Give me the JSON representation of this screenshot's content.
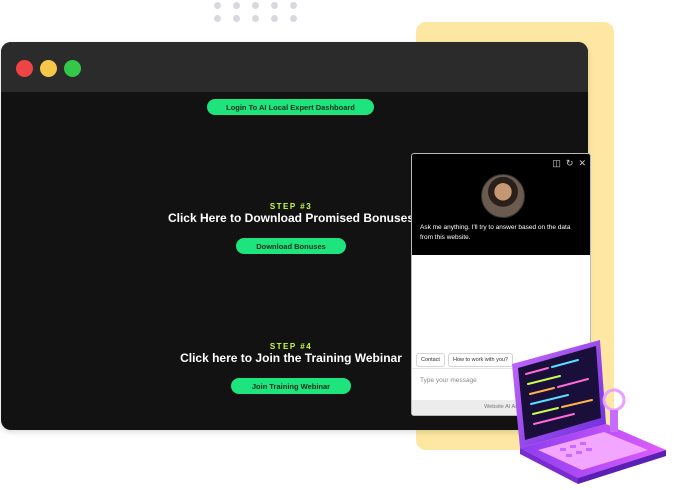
{
  "traffic_lights": {
    "close_color": "#ef4444",
    "minimize_color": "#f6c84a",
    "maximize_color": "#34c84a"
  },
  "dashboard_button": {
    "label": "Login To AI Local Expert Dashboard"
  },
  "step3": {
    "step_label": "STEP #3",
    "heading": "Click Here to Download Promised Bonuses",
    "button_label": "Download Bonuses"
  },
  "step4": {
    "step_label": "STEP #4",
    "heading": "Click here to Join the Training Webinar",
    "button_label": "Join Training Webinar"
  },
  "chat": {
    "message": "Ask me anything. I'll try to answer based on the data from this website.",
    "chips": [
      "Contact",
      "How to work with you?"
    ],
    "input_placeholder": "Type your message",
    "footer": "Website AI As"
  },
  "accent_color": "#1de47c"
}
